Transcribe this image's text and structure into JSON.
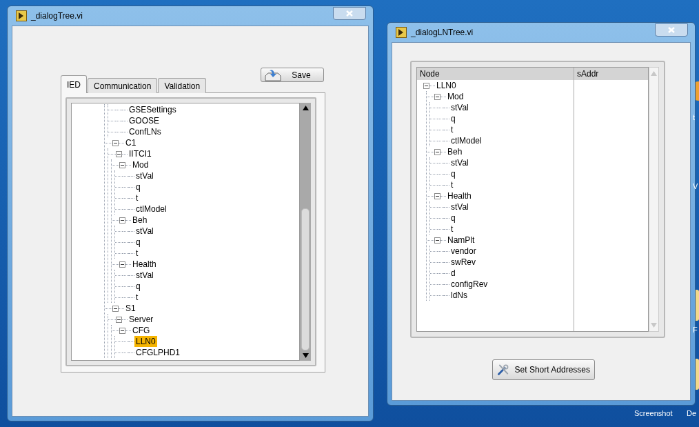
{
  "window_1": {
    "title": "_dialogTree.vi",
    "save_button": "Save",
    "tabs": [
      {
        "label": "IED",
        "selected": true
      },
      {
        "label": "Communication",
        "selected": false
      },
      {
        "label": "Validation",
        "selected": false
      }
    ],
    "tree": {
      "items": [
        {
          "children": [
            {
              "label": "GSESettings",
              "selected": false
            },
            {
              "label": "GOOSE",
              "selected": false
            },
            {
              "label": "ConfLNs",
              "selected": false
            }
          ]
        },
        {
          "label": "C1",
          "selected": false,
          "expanded": true,
          "children": [
            {
              "label": "IITCI1",
              "selected": false,
              "expanded": true,
              "children": [
                {
                  "label": "Mod",
                  "selected": false,
                  "expanded": true,
                  "children": [
                    {
                      "label": "stVal",
                      "selected": false
                    },
                    {
                      "label": "q",
                      "selected": false
                    },
                    {
                      "label": "t",
                      "selected": false
                    },
                    {
                      "label": "ctlModel",
                      "selected": false
                    }
                  ]
                },
                {
                  "label": "Beh",
                  "selected": false,
                  "expanded": true,
                  "children": [
                    {
                      "label": "stVal",
                      "selected": false
                    },
                    {
                      "label": "q",
                      "selected": false
                    },
                    {
                      "label": "t",
                      "selected": false
                    }
                  ]
                },
                {
                  "label": "Health",
                  "selected": false,
                  "expanded": true,
                  "children": [
                    {
                      "label": "stVal",
                      "selected": false
                    },
                    {
                      "label": "q",
                      "selected": false
                    },
                    {
                      "label": "t",
                      "selected": false
                    }
                  ]
                }
              ]
            }
          ]
        },
        {
          "label": "S1",
          "selected": false,
          "expanded": true,
          "children": [
            {
              "label": "Server",
              "selected": false,
              "expanded": true,
              "children": [
                {
                  "label": "CFG",
                  "selected": false,
                  "expanded": true,
                  "children": [
                    {
                      "label": "LLN0",
                      "selected": true
                    },
                    {
                      "label": "CFGLPHD1",
                      "selected": false
                    }
                  ]
                }
              ]
            }
          ]
        }
      ]
    }
  },
  "window_2": {
    "title": "_dialogLNTree.vi",
    "table": {
      "columns": [
        "Node",
        "sAddr"
      ],
      "items": [
        {
          "label": "LLN0",
          "expanded": true,
          "children": [
            {
              "label": "Mod",
              "expanded": true,
              "children": [
                {
                  "label": "stVal"
                },
                {
                  "label": "q"
                },
                {
                  "label": "t"
                },
                {
                  "label": "ctlModel"
                }
              ]
            },
            {
              "label": "Beh",
              "expanded": true,
              "children": [
                {
                  "label": "stVal"
                },
                {
                  "label": "q"
                },
                {
                  "label": "t"
                }
              ]
            },
            {
              "label": "Health",
              "expanded": true,
              "children": [
                {
                  "label": "stVal"
                },
                {
                  "label": "q"
                },
                {
                  "label": "t"
                }
              ]
            },
            {
              "label": "NamPlt",
              "expanded": true,
              "children": [
                {
                  "label": "vendor"
                },
                {
                  "label": "swRev"
                },
                {
                  "label": "d"
                },
                {
                  "label": "configRev"
                },
                {
                  "label": "ldNs"
                }
              ]
            }
          ]
        }
      ]
    },
    "button": "Set Short Addresses"
  },
  "desktop_labels": [
    "t",
    "V",
    "F",
    "Screenshot",
    "De"
  ]
}
